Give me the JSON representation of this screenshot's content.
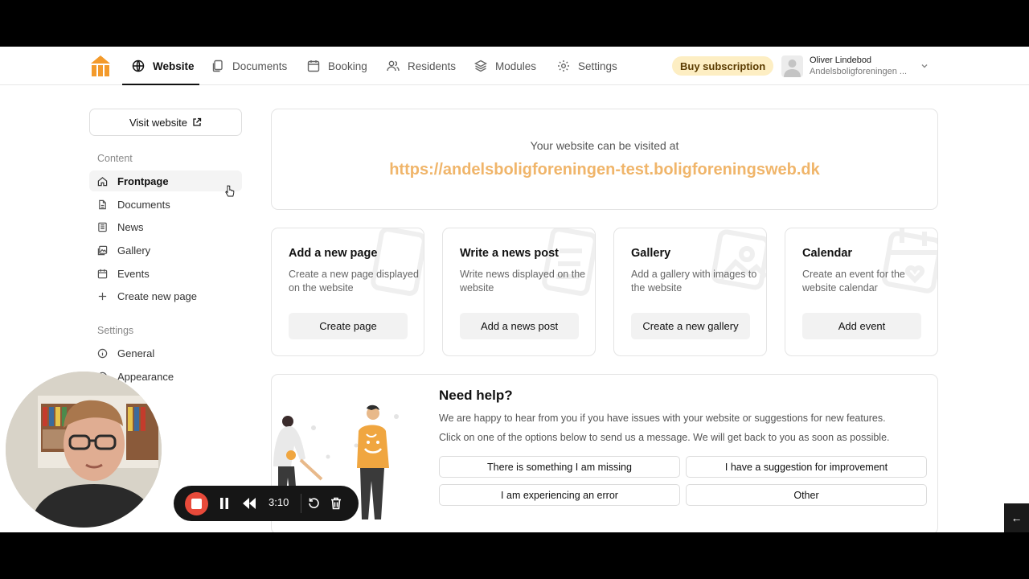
{
  "nav": {
    "items": [
      {
        "label": "Website",
        "icon": "globe-icon"
      },
      {
        "label": "Documents",
        "icon": "documents-icon"
      },
      {
        "label": "Booking",
        "icon": "calendar-icon"
      },
      {
        "label": "Residents",
        "icon": "users-icon"
      },
      {
        "label": "Modules",
        "icon": "layers-icon"
      },
      {
        "label": "Settings",
        "icon": "gear-icon"
      }
    ],
    "active": "Website",
    "buy_label": "Buy subscription",
    "user_name": "Oliver Lindebod",
    "user_org": "Andelsboligforeningen ..."
  },
  "sidebar": {
    "visit_label": "Visit website",
    "content_heading": "Content",
    "content_items": [
      {
        "label": "Frontpage",
        "icon": "home-icon"
      },
      {
        "label": "Documents",
        "icon": "document-icon"
      },
      {
        "label": "News",
        "icon": "newspaper-icon"
      },
      {
        "label": "Gallery",
        "icon": "gallery-icon"
      },
      {
        "label": "Events",
        "icon": "calendar-icon"
      },
      {
        "label": "Create new page",
        "icon": "plus-icon"
      }
    ],
    "settings_heading": "Settings",
    "settings_items": [
      {
        "label": "General",
        "icon": "info-icon"
      },
      {
        "label": "Appearance",
        "icon": "palette-icon"
      }
    ]
  },
  "url_card": {
    "label": "Your website can be visited at",
    "url": "https://andelsboligforeningen-test.boligforeningsweb.dk"
  },
  "actions": [
    {
      "title": "Add a new page",
      "desc": "Create a new page displayed on the website",
      "button": "Create page"
    },
    {
      "title": "Write a news post",
      "desc": "Write news displayed on the website",
      "button": "Add a news post"
    },
    {
      "title": "Gallery",
      "desc": "Add a gallery with images to the website",
      "button": "Create a new gallery"
    },
    {
      "title": "Calendar",
      "desc": "Create an event for the website calendar",
      "button": "Add event"
    }
  ],
  "help": {
    "title": "Need help?",
    "text1": "We are happy to hear from you if you have issues with your website or suggestions for new features.",
    "text2": "Click on one of the options below to send us a message. We will get back to you as soon as possible.",
    "options": [
      "There is something I am missing",
      "I have a suggestion for improvement",
      "I am experiencing an error",
      "Other"
    ]
  },
  "recorder": {
    "time": "3:10"
  },
  "colors": {
    "accent": "#f0b56a",
    "logo": "#f39a2b",
    "buy_bg": "#fdeec3",
    "record": "#e84a3a"
  }
}
